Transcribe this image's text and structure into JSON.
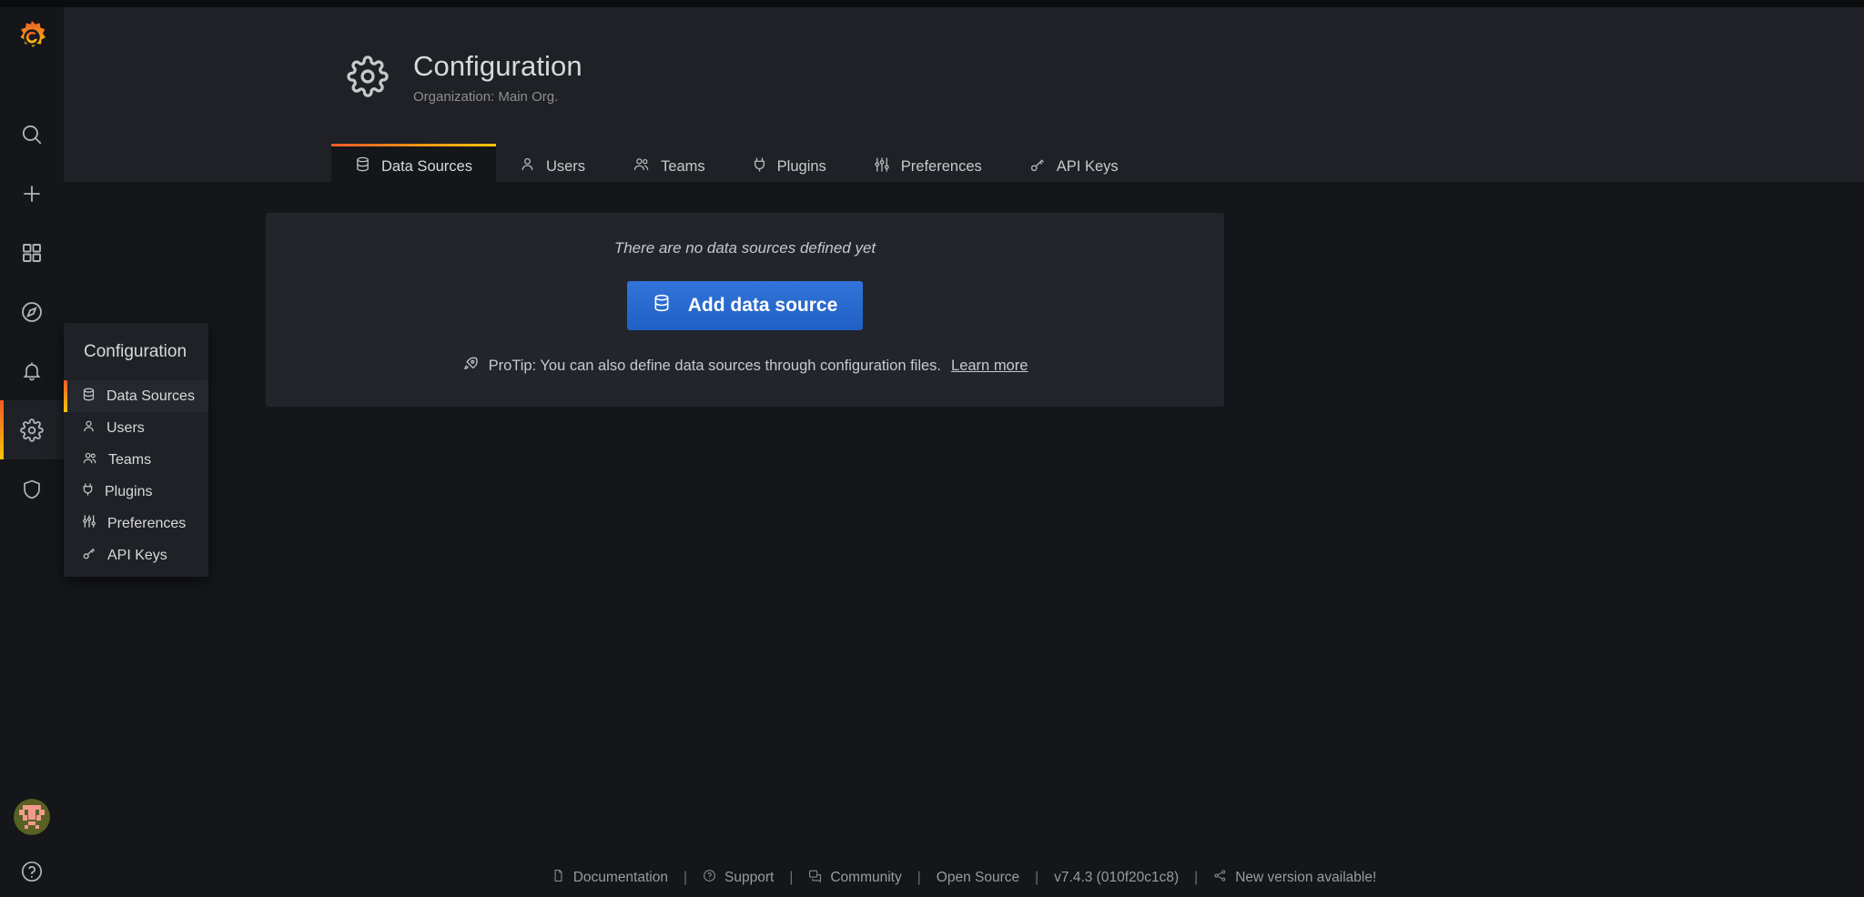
{
  "app": {
    "logo_name": "grafana-logo"
  },
  "sidebar": {
    "items": [
      {
        "icon": "search-icon",
        "name": "search"
      },
      {
        "icon": "plus-icon",
        "name": "create"
      },
      {
        "icon": "dashboards-icon",
        "name": "dashboards"
      },
      {
        "icon": "compass-icon",
        "name": "explore"
      },
      {
        "icon": "bell-icon",
        "name": "alerting"
      },
      {
        "icon": "gear-icon",
        "name": "configuration"
      },
      {
        "icon": "shield-icon",
        "name": "server-admin"
      }
    ],
    "bottom": [
      {
        "icon": "avatar",
        "name": "user-avatar"
      },
      {
        "icon": "help-icon",
        "name": "help"
      }
    ]
  },
  "submenu": {
    "title": "Configuration",
    "items": [
      {
        "label": "Data Sources",
        "icon": "database-icon",
        "active": true
      },
      {
        "label": "Users",
        "icon": "user-icon",
        "active": false
      },
      {
        "label": "Teams",
        "icon": "users-icon",
        "active": false
      },
      {
        "label": "Plugins",
        "icon": "plug-icon",
        "active": false
      },
      {
        "label": "Preferences",
        "icon": "sliders-icon",
        "active": false
      },
      {
        "label": "API Keys",
        "icon": "key-icon",
        "active": false
      }
    ]
  },
  "header": {
    "icon": "gear-icon",
    "title": "Configuration",
    "subtitle": "Organization: Main Org."
  },
  "tabs": [
    {
      "label": "Data Sources",
      "icon": "database-icon",
      "active": true
    },
    {
      "label": "Users",
      "icon": "user-icon",
      "active": false
    },
    {
      "label": "Teams",
      "icon": "users-icon",
      "active": false
    },
    {
      "label": "Plugins",
      "icon": "plug-icon",
      "active": false
    },
    {
      "label": "Preferences",
      "icon": "sliders-icon",
      "active": false
    },
    {
      "label": "API Keys",
      "icon": "key-icon",
      "active": false
    }
  ],
  "main": {
    "empty_message": "There are no data sources defined yet",
    "add_button": {
      "label": "Add data source",
      "icon": "database-icon"
    },
    "protip": {
      "icon": "rocket-icon",
      "text": "ProTip: You can also define data sources through configuration files.",
      "link_label": "Learn more"
    }
  },
  "footer": {
    "links": [
      {
        "label": "Documentation",
        "icon": "document-icon"
      },
      {
        "label": "Support",
        "icon": "question-circle-icon"
      },
      {
        "label": "Community",
        "icon": "comments-icon"
      },
      {
        "label": "Open Source",
        "icon": "none"
      },
      {
        "label": "v7.4.3 (010f20c1c8)",
        "icon": "none"
      },
      {
        "label": "New version available!",
        "icon": "share-icon"
      }
    ],
    "separator": "|"
  },
  "colors": {
    "accent_start": "#f05a28",
    "accent_end": "#fbc50a",
    "primary_button": "#3274d9",
    "page_bg": "#141619",
    "panel_bg": "#1f2126",
    "card_bg": "#22252b",
    "text": "#d8d9da"
  }
}
